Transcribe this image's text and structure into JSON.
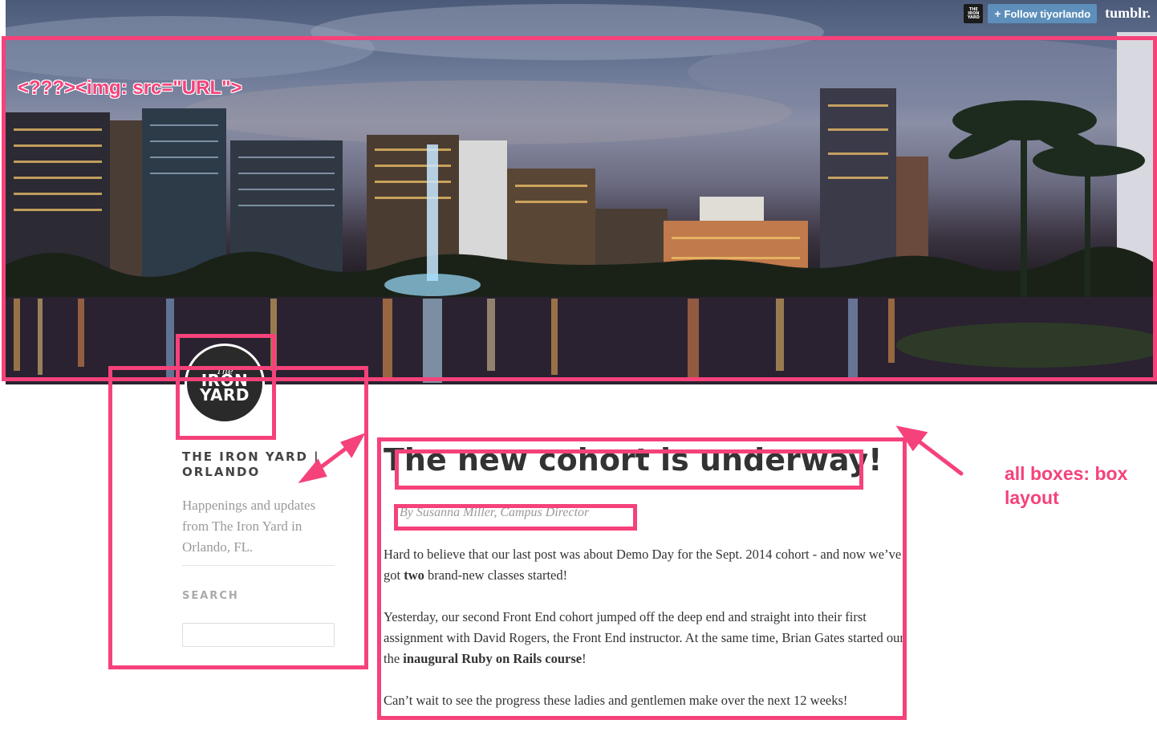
{
  "tumblr": {
    "avatar_text": "THE IRON YARD",
    "follow_label": "Follow tiyorlando",
    "logo_text": "tumblr."
  },
  "header": {
    "image_annotation": "<???><img: src=\"URL\">"
  },
  "logo": {
    "top_word": "The",
    "line1": "IRON",
    "line2": "YARD"
  },
  "sidebar": {
    "site_title": "THE IRON YARD | ORLANDO",
    "description": "Happenings and updates from The Iron Yard in Orlando, FL.",
    "search_label": "SEARCH",
    "search_value": ""
  },
  "post": {
    "title": "The new cohort is underway!",
    "byline": "By Susanna Miller, Campus Director",
    "p1_a": "Hard to believe that our last post was about Demo Day for the Sept. 2014 cohort - and now we’ve got ",
    "p1_b": "two",
    "p1_c": " brand-new classes started!",
    "p2_a": "Yesterday, our second Front End cohort jumped off the deep end and straight into their first assignment with David Rogers, the Front End instructor. At the same time, Brian Gates started our the ",
    "p2_b": "inaugural Ruby on Rails course",
    "p2_c": "!",
    "p3": "Can’t wait to see the progress these ladies and gentlemen make over the next 12 weeks!"
  },
  "annotations": {
    "layout_note": "all boxes: box layout"
  },
  "colors": {
    "annotation": "#f5427a",
    "follow_button": "#5d8fba",
    "logo_bg": "#2a2a2a"
  }
}
